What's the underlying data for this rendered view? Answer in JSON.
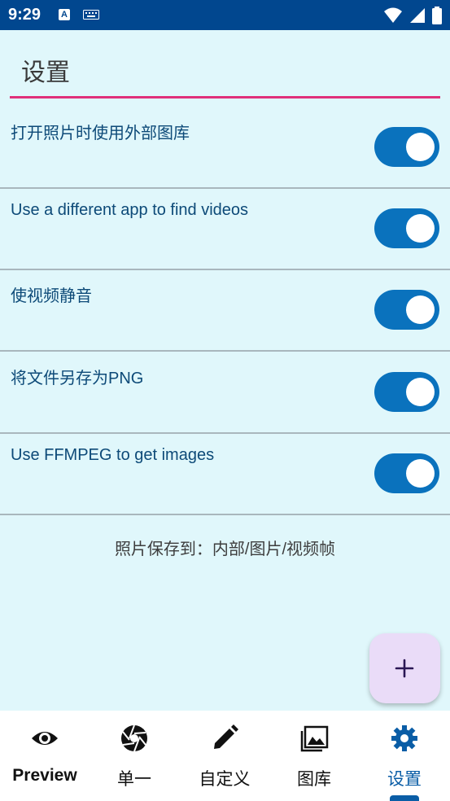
{
  "status_bar": {
    "time": "9:29",
    "a_icon_letter": "A",
    "icons": [
      "text-input-icon",
      "keyboard-icon",
      "wifi-icon",
      "signal-icon",
      "battery-icon"
    ]
  },
  "header": {
    "title": "设置"
  },
  "settings": [
    {
      "label": "打开照片时使用外部图库",
      "enabled": true
    },
    {
      "label": "Use a different app to find videos",
      "enabled": true
    },
    {
      "label": "使视频静音",
      "enabled": true
    },
    {
      "label": "将文件另存为PNG",
      "enabled": true
    },
    {
      "label": "Use FFMPEG to get images",
      "enabled": true
    }
  ],
  "save_path": "照片保存到：内部/图片/视频帧",
  "fab": {
    "icon": "plus-icon"
  },
  "bottom_nav": {
    "items": [
      {
        "label": "Preview",
        "icon": "eye-icon"
      },
      {
        "label": "单一",
        "icon": "camera-shutter-icon"
      },
      {
        "label": "自定义",
        "icon": "pencil-icon"
      },
      {
        "label": "图库",
        "icon": "gallery-icon"
      },
      {
        "label": "设置",
        "icon": "gear-icon"
      }
    ],
    "active_index": 4
  },
  "colors": {
    "accent": "#0a72bd",
    "status_bar": "#01478f",
    "header_underline": "#e0307a",
    "background": "#e0f7fb",
    "fab_bg": "#eadcf8"
  }
}
